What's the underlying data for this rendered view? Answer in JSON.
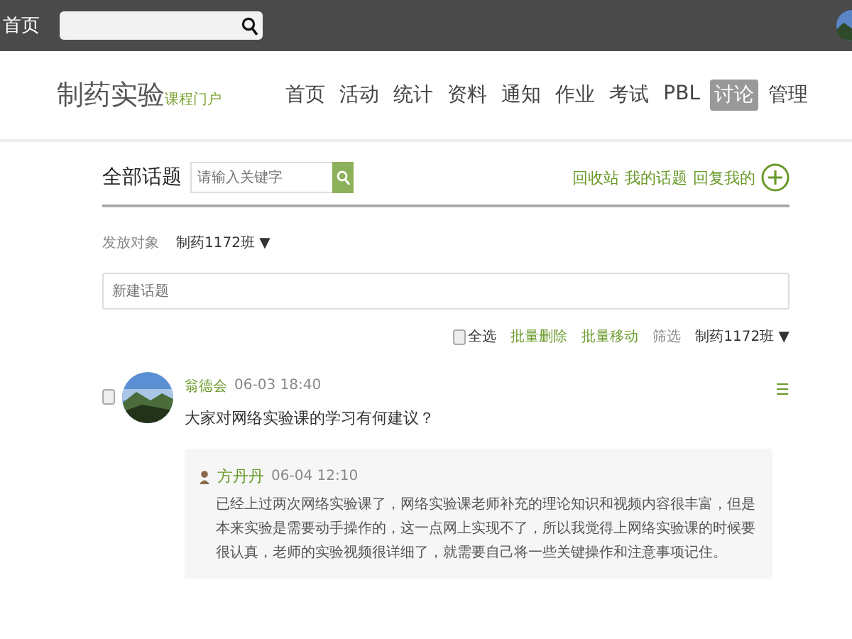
{
  "topbar": {
    "home_label": "首页"
  },
  "header": {
    "logo": "制药实验",
    "logo_sub": "课程门户",
    "nav": [
      {
        "label": "首页",
        "selected": false
      },
      {
        "label": "活动",
        "selected": false
      },
      {
        "label": "统计",
        "selected": false
      },
      {
        "label": "资料",
        "selected": false
      },
      {
        "label": "通知",
        "selected": false
      },
      {
        "label": "作业",
        "selected": false
      },
      {
        "label": "考试",
        "selected": false
      },
      {
        "label": "PBL",
        "selected": false
      },
      {
        "label": "讨论",
        "selected": true
      },
      {
        "label": "管理",
        "selected": false
      }
    ]
  },
  "topics": {
    "title": "全部话题",
    "search_placeholder": "请输入关键字",
    "links": [
      "回收站",
      "我的话题",
      "回复我的"
    ],
    "target_label": "发放对象",
    "target_value": "制药1172班",
    "target_caret": "▼",
    "new_topic_placeholder": "新建话题",
    "toolbar": {
      "select_all": {
        "label": "全选",
        "checked": false
      },
      "actions": [
        "批量删除",
        "批量移动"
      ],
      "filter_label": "筛选",
      "filter_value": "制药1172班",
      "filter_caret": "▼"
    },
    "posts": [
      {
        "author": "翁德会",
        "time": "06-03 18:40",
        "checked": false,
        "title": "大家对网络实验课的学习有何建议？",
        "menu_icon": "☰",
        "replies": [
          {
            "author": "方丹丹",
            "time": "06-04 12:10",
            "text": "已经上过两次网络实验课了，网络实验课老师补充的理论知识和视频内容很丰富，但是本来实验是需要动手操作的，这一点网上实现不了，所以我觉得上网络实验课的时候要很认真，老师的实验视频很详细了，就需要自己将一些关键操作和注意事项记住。"
          }
        ]
      }
    ]
  }
}
